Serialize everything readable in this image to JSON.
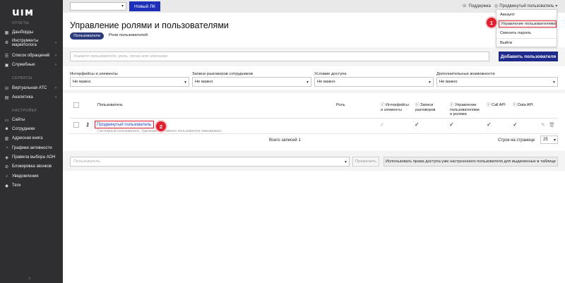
{
  "sidebar": {
    "logo": "uıм",
    "sections": {
      "reports": "ОТЧЕТЫ",
      "services": "СЕРВИСЫ",
      "settings": "НАСТРОЙКИ"
    },
    "items": [
      {
        "label": "Дашборды",
        "icon": "dashboard-icon"
      },
      {
        "label": "Инструменты маркетолога",
        "icon": "tools-icon"
      },
      {
        "label": "Список обращений",
        "icon": "list-icon"
      },
      {
        "label": "Служебные",
        "icon": "service-icon"
      },
      {
        "label": "Виртуальная АТС",
        "icon": "phone-icon"
      },
      {
        "label": "Аналитика",
        "icon": "chart-icon"
      },
      {
        "label": "Сайты",
        "icon": "sites-icon"
      },
      {
        "label": "Сотрудники",
        "icon": "users-icon"
      },
      {
        "label": "Адресная книга",
        "icon": "book-icon"
      },
      {
        "label": "Графики активности",
        "icon": "graph-icon"
      },
      {
        "label": "Правила выбора АОН",
        "icon": "rules-icon"
      },
      {
        "label": "Блокировка звонков",
        "icon": "block-icon"
      },
      {
        "label": "Уведомления",
        "icon": "bell-icon"
      },
      {
        "label": "Теги",
        "icon": "tag-icon"
      }
    ]
  },
  "topbar": {
    "new_lk": "Новый ЛК",
    "support": "Поддержка",
    "user": "Продвинутый пользователь"
  },
  "dropdown": {
    "items": [
      "Аккаунт",
      "Управление пользователями",
      "Сменить пароль",
      "Выйти"
    ]
  },
  "badges": [
    "1",
    "2"
  ],
  "page": {
    "title": "Управление ролями и пользователями",
    "tabs": [
      "Пользователи",
      "Роли пользователей"
    ],
    "search_placeholder": "Укажите пользователя, роль, логин или описание",
    "add_user": "Добавить пользователя"
  },
  "filters": [
    {
      "label": "Интерфейсы и элементы",
      "value": "Не важно"
    },
    {
      "label": "Записи разговоров сотрудников",
      "value": "Не важно"
    },
    {
      "label": "Условие доступа",
      "value": "Не важно"
    },
    {
      "label": "Дополнительные возможности",
      "value": "Не важно"
    }
  ],
  "table": {
    "headers": [
      "Пользователь",
      "Роль",
      "Интерфейсы и элементы",
      "Записи разговоров",
      "Управление пользователями и ролями",
      "Call API",
      "Data API"
    ],
    "rows": [
      {
        "user": "Продвинутый пользователь",
        "note": "Системный пользователь. Удаление системного пользователя невозможно.",
        "role": "",
        "interfaces": true,
        "records": true,
        "management": true,
        "call_api": true,
        "data_api": true
      }
    ],
    "total": "Всего записей 1",
    "per_page_label": "Строк на странице",
    "per_page": "25"
  },
  "bulk": {
    "user_placeholder": "Пользователь",
    "apply": "Применить",
    "use_rights": "Использовать права доступа уже настроенного пользователя для выделенных в таблице"
  },
  "sidebar_bottom": "?",
  "colors": {
    "accent": "#1d2fb8",
    "highlight": "#e0202e",
    "sidebar": "#2f2f32"
  }
}
